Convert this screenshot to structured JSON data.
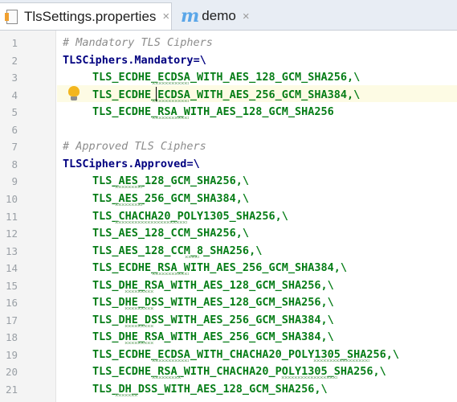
{
  "tabs": [
    {
      "label": "TlsSettings.properties",
      "icon": "properties-file-icon",
      "active": true
    },
    {
      "label": "demo",
      "icon": "markdown-m-icon",
      "active": false
    }
  ],
  "close_glyph": "×",
  "line_numbers": [
    "1",
    "2",
    "3",
    "4",
    "5",
    "6",
    "7",
    "8",
    "9",
    "10",
    "11",
    "12",
    "13",
    "14",
    "15",
    "16",
    "17",
    "18",
    "19",
    "20",
    "21"
  ],
  "lines": [
    {
      "type": "comment",
      "text": "# Mandatory TLS Ciphers"
    },
    {
      "type": "key",
      "key": "TLSCiphers.Mandatory",
      "rest": "=\\"
    },
    {
      "type": "value",
      "text": "TLS_ECDHE_ECDSA_WITH_AES_128_GCM_SHA256,\\"
    },
    {
      "type": "value",
      "text": "TLS_ECDHE_ECDSA_WITH_AES_256_GCM_SHA384,\\"
    },
    {
      "type": "value",
      "text": "TLS_ECDHE_RSA_WITH_AES_128_GCM_SHA256"
    },
    {
      "type": "blank",
      "text": ""
    },
    {
      "type": "comment",
      "text": "# Approved TLS Ciphers"
    },
    {
      "type": "key",
      "key": "TLSCiphers.Approved",
      "rest": "=\\"
    },
    {
      "type": "value",
      "text": "TLS_AES_128_GCM_SHA256,\\"
    },
    {
      "type": "value",
      "text": "TLS_AES_256_GCM_SHA384,\\"
    },
    {
      "type": "value",
      "text": "TLS_CHACHA20_POLY1305_SHA256,\\"
    },
    {
      "type": "value",
      "text": "TLS_AES_128_CCM_SHA256,\\"
    },
    {
      "type": "value",
      "text": "TLS_AES_128_CCM_8_SHA256,\\"
    },
    {
      "type": "value",
      "text": "TLS_ECDHE_RSA_WITH_AES_256_GCM_SHA384,\\"
    },
    {
      "type": "value",
      "text": "TLS_DHE_RSA_WITH_AES_128_GCM_SHA256,\\"
    },
    {
      "type": "value",
      "text": "TLS_DHE_DSS_WITH_AES_128_GCM_SHA256,\\"
    },
    {
      "type": "value",
      "text": "TLS_DHE_DSS_WITH_AES_256_GCM_SHA384,\\"
    },
    {
      "type": "value",
      "text": "TLS_DHE_RSA_WITH_AES_256_GCM_SHA384,\\"
    },
    {
      "type": "value",
      "text": "TLS_ECDHE_ECDSA_WITH_CHACHA20_POLY1305_SHA256,\\"
    },
    {
      "type": "value",
      "text": "TLS_ECDHE_RSA_WITH_CHACHA20_POLY1305_SHA256,\\"
    },
    {
      "type": "value",
      "text": "TLS_DH_DSS_WITH_AES_128_GCM_SHA256,\\"
    }
  ],
  "current_line": 4,
  "intention_icon": "lightbulb-icon",
  "colors": {
    "comment": "#8c8c8c",
    "key": "#000080",
    "value": "#067d17",
    "bulb": "#f3b61f",
    "markdown_icon": "#5aa6e8"
  }
}
